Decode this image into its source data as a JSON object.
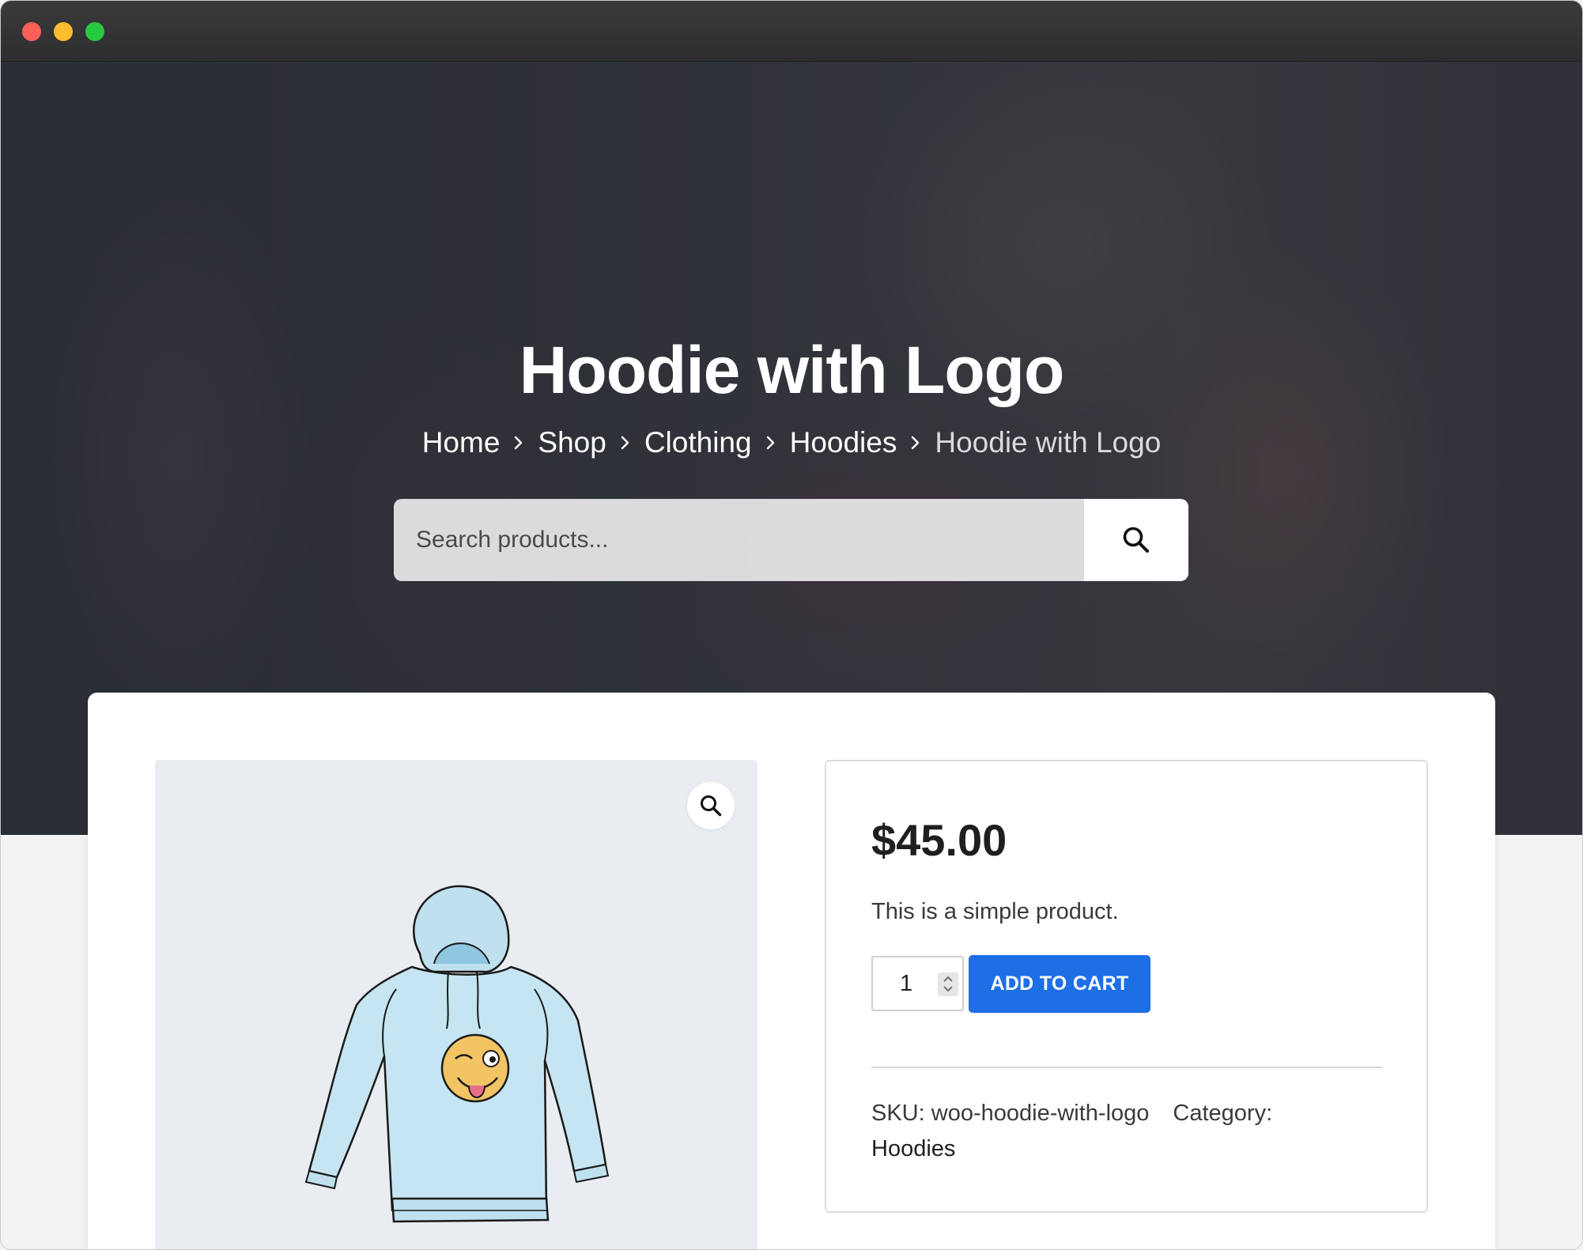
{
  "window": {
    "controls": [
      "close",
      "minimize",
      "maximize"
    ]
  },
  "hero": {
    "title": "Hoodie with Logo",
    "breadcrumb": [
      {
        "label": "Home"
      },
      {
        "label": "Shop"
      },
      {
        "label": "Clothing"
      },
      {
        "label": "Hoodies"
      },
      {
        "label": "Hoodie with Logo"
      }
    ],
    "search": {
      "placeholder": "Search products..."
    }
  },
  "product": {
    "image_icon": "hoodie-with-winking-emoji-icon",
    "price": "$45.00",
    "short_description": "This is a simple product.",
    "quantity": "1",
    "add_to_cart_label": "ADD TO CART",
    "sku_label": "SKU:",
    "sku": "woo-hoodie-with-logo",
    "category_label": "Category:",
    "category": "Hoodies"
  },
  "colors": {
    "accent": "#1e6fe6",
    "hero_overlay": "#222838",
    "gallery_bg": "#e9edf1"
  }
}
